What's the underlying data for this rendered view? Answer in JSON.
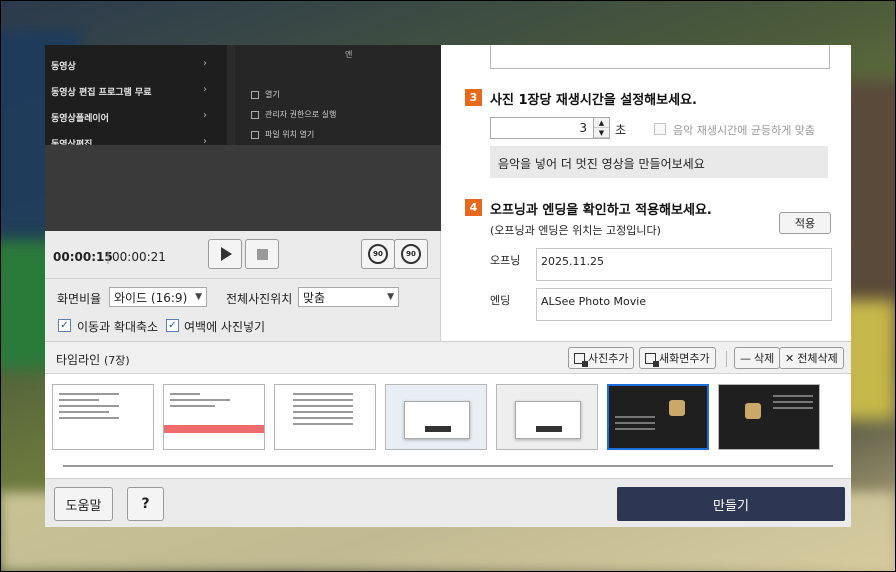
{
  "preview": {
    "left_menu": [
      "동영상",
      "동영상 편집 프로그램 무료",
      "동영상플레이어",
      "동영상편집"
    ],
    "arrow": "›",
    "context_header": "엔",
    "context_items": [
      "열기",
      "관리자 권한으로 실행",
      "파일 위치 열기"
    ]
  },
  "playback": {
    "current_time": "00:00:15",
    "separator": "|",
    "total_time": "00:00:21",
    "rotate_left_label": "90",
    "rotate_right_label": "90"
  },
  "options": {
    "aspect_label": "화면비율",
    "aspect_value": "와이드 (16:9)",
    "position_label": "전체사진위치",
    "position_value": "맞춤",
    "zoom_label": "이동과 확대축소",
    "margin_label": "여백에 사진넣기",
    "check_mark": "✓"
  },
  "settings": {
    "step3_num": "3",
    "step3_title": "사진 1장당 재생시간을 설정해보세요.",
    "duration_value": "3",
    "duration_unit": "초",
    "music_sync_label": "음악 재생시간에 균등하게 맞춤",
    "hint": "음악을 넣어 더 멋진 영상을 만들어보세요",
    "step4_num": "4",
    "step4_title": "오프닝과 엔딩을 확인하고 적용해보세요.",
    "step4_note": "(오프닝과 엔딩은 위치는 고정입니다)",
    "apply_label": "적용",
    "opening_label": "오프닝",
    "opening_value": "2025.11.25",
    "ending_label": "엔딩",
    "ending_value": "ALSee Photo Movie"
  },
  "timeline": {
    "title": "타임라인",
    "count": "(7장)",
    "add_photo": "사진추가",
    "add_screen": "새화면추가",
    "delete": "삭제",
    "delete_all": "전체삭제",
    "selected_index": 5
  },
  "footer": {
    "help": "도움말",
    "question": "?",
    "make": "만들기"
  },
  "colors": {
    "accent": "#e8691c",
    "make_button": "#2d3753",
    "selection": "#1e6fd9"
  }
}
